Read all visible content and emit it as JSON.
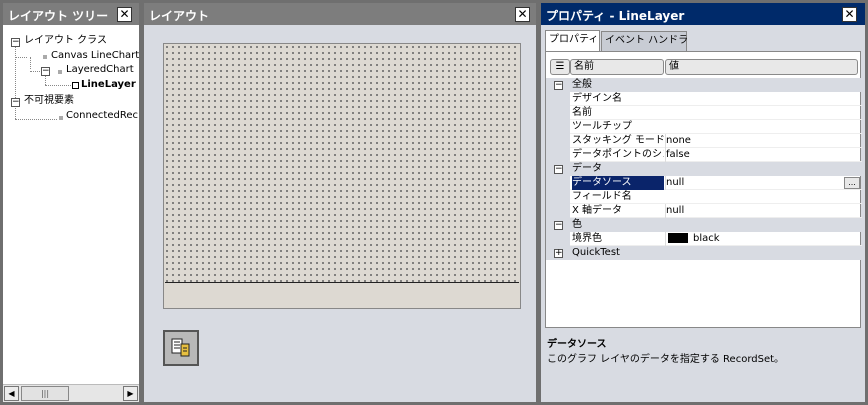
{
  "left_panel": {
    "title": "レイアウト ツリー",
    "close": "✕",
    "tree": {
      "root": "レイアウト クラス",
      "canvas": "Canvas LineChart",
      "layered": "LayeredChart",
      "linelayer": "LineLayer",
      "invisible": "不可視要素",
      "connected": "ConnectedRec"
    },
    "scroll_left": "◀",
    "scroll_right": "▶",
    "scroll_thumb": "|||"
  },
  "center_panel": {
    "title": "レイアウト",
    "close": "✕"
  },
  "right_panel": {
    "title": "プロパティ - LineLayer",
    "close": "✕",
    "tabs": [
      "プロパティ",
      "イベント ハンドラ"
    ],
    "header": {
      "sort_icon": "☰",
      "name": "名前",
      "value": "値"
    },
    "categories": {
      "general": "全般",
      "data": "データ",
      "color": "色",
      "quicktest": "QuickTest"
    },
    "rows": {
      "design_name": {
        "label": "デザイン名",
        "value": ""
      },
      "name": {
        "label": "名前",
        "value": ""
      },
      "tooltip": {
        "label": "ツールチップ",
        "value": ""
      },
      "stacking": {
        "label": "スタッキング モード",
        "value": "none"
      },
      "datapoint": {
        "label": "データポイントのシン",
        "value": "false"
      },
      "datasource": {
        "label": "データソース",
        "value": "null"
      },
      "fieldname": {
        "label": "フィールド名",
        "value": ""
      },
      "xaxis": {
        "label": "X 軸データ",
        "value": "null"
      },
      "border": {
        "label": "境界色",
        "value": "black"
      }
    },
    "ellipsis": "...",
    "description": {
      "title": "データソース",
      "text": "このグラフ レイヤのデータを指定する RecordSet。"
    }
  },
  "colors": {
    "title_inactive": "#7d7d7d",
    "title_active": "#002a6a",
    "selection": "#0a246a"
  }
}
